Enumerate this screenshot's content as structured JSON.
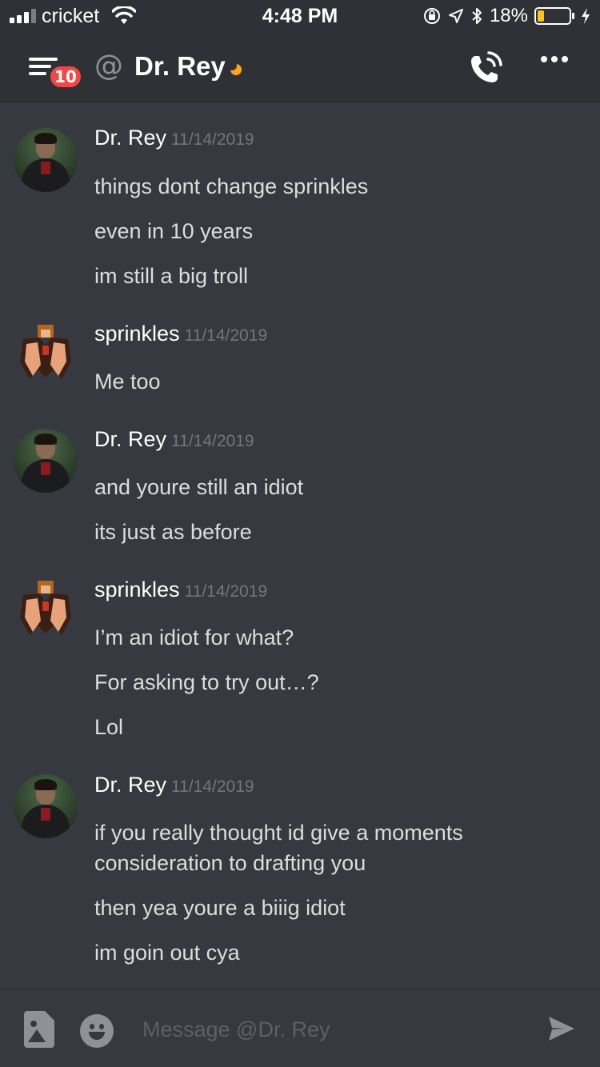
{
  "status_bar": {
    "carrier": "cricket",
    "time": "4:48 PM",
    "battery_percent": "18%",
    "battery_level": 0.18,
    "icons": [
      "signal-icon",
      "wifi-icon",
      "orientation-lock-icon",
      "location-icon",
      "bluetooth-icon",
      "battery-icon",
      "charging-icon"
    ]
  },
  "header": {
    "badge_count": "10",
    "at_symbol": "@",
    "dm_name": "Dr. Rey",
    "presence": "idle",
    "colors": {
      "badge": "#f04747",
      "idle": "#faa61a"
    }
  },
  "messages": [
    {
      "author": "Dr. Rey",
      "timestamp": "11/14/2019",
      "avatar": "dr-rey-avatar",
      "lines": [
        "things dont change sprinkles",
        "even in 10 years",
        "im still a big troll"
      ]
    },
    {
      "author": "sprinkles",
      "timestamp": "11/14/2019",
      "avatar": "sprinkles-avatar",
      "lines": [
        "Me too"
      ]
    },
    {
      "author": "Dr. Rey",
      "timestamp": "11/14/2019",
      "avatar": "dr-rey-avatar",
      "lines": [
        "and youre still an idiot",
        "its just as before"
      ]
    },
    {
      "author": "sprinkles",
      "timestamp": "11/14/2019",
      "avatar": "sprinkles-avatar",
      "lines": [
        "I’m an idiot for what?",
        "For asking to try out…?",
        "Lol"
      ]
    },
    {
      "author": "Dr. Rey",
      "timestamp": "11/14/2019",
      "avatar": "dr-rey-avatar",
      "lines": [
        "if you really thought id give a moments",
        "consideration to drafting you",
        "then yea youre a biiig idiot",
        "im goin out cya"
      ]
    }
  ],
  "composer": {
    "placeholder": "Message @Dr. Rey",
    "value": ""
  }
}
